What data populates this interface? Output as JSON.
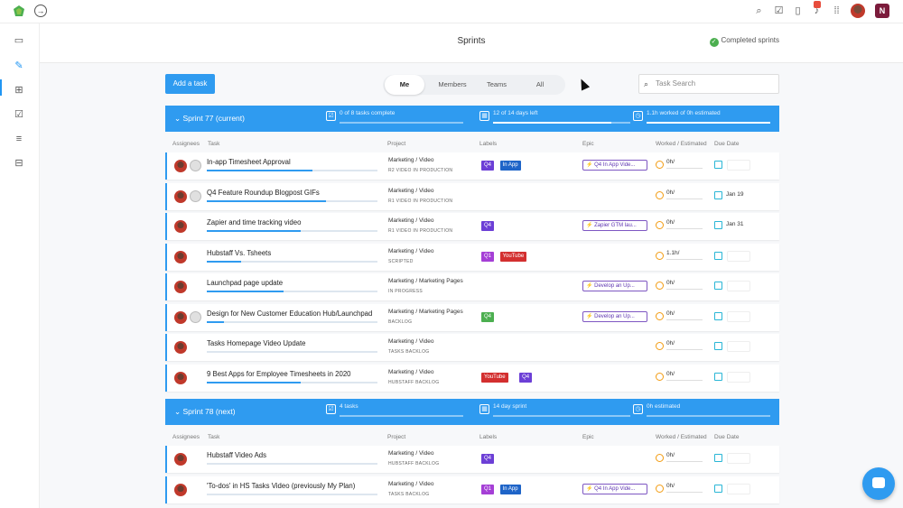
{
  "topbar": {
    "icons": [
      "logo-icon",
      "back-arrow-icon",
      "search-icon",
      "checkbox-icon",
      "timer-icon",
      "bell-icon",
      "grid-icon"
    ],
    "user_initial": "N"
  },
  "header": {
    "title": "Sprints",
    "completed_label": "Completed sprints"
  },
  "sidebar": {
    "icons": [
      "folder-icon",
      "pencil-icon",
      "plus-square-icon",
      "check-square-icon",
      "layers-icon",
      "archive-icon"
    ]
  },
  "toolbar": {
    "add_task": "Add a task",
    "filters": [
      "Me",
      "Members",
      "Teams",
      "All"
    ],
    "search_placeholder": "Task Search"
  },
  "columns": {
    "assignees": "Assignees",
    "task": "Task",
    "project": "Project",
    "labels": "Labels",
    "epic": "Epic",
    "worked": "Worked / Estimated",
    "due": "Due Date"
  },
  "sprints": [
    {
      "name": "Sprint 77 (current)",
      "stats": [
        {
          "text": "0 of 8 tasks complete",
          "progress": 0.0
        },
        {
          "text": "12 of 14 days left",
          "progress": 0.86
        },
        {
          "text": "1.1h worked of 0h estimated",
          "progress": 1.0
        }
      ],
      "tasks": [
        {
          "name": "In-app Timesheet Approval",
          "progress": 0.62,
          "project": "Marketing / Video",
          "status": "R2 VIDEO IN PRODUCTION",
          "labels": [
            {
              "t": "Q4",
              "c": "#6c3fd6"
            },
            {
              "t": "In App",
              "c": "#1e64c8"
            }
          ],
          "epic": "Q4 In App Vide...",
          "worked": "0h/",
          "due": "",
          "two": true
        },
        {
          "name": "Q4 Feature Roundup Blogpost GIFs",
          "progress": 0.7,
          "project": "Marketing / Video",
          "status": "R1 VIDEO IN PRODUCTION",
          "labels": [],
          "epic": "",
          "worked": "0h/",
          "due": "Jan 19",
          "two": true
        },
        {
          "name": "Zapier and time tracking video",
          "progress": 0.55,
          "project": "Marketing / Video",
          "status": "R1 VIDEO IN PRODUCTION",
          "labels": [
            {
              "t": "Q4",
              "c": "#6c3fd6"
            }
          ],
          "epic": "Zapier GTM lau...",
          "worked": "0h/",
          "due": "Jan 31",
          "two": false
        },
        {
          "name": "Hubstaff Vs. Tsheets",
          "progress": 0.2,
          "project": "Marketing / Video",
          "status": "SCRIPTED",
          "labels": [
            {
              "t": "Q1",
              "c": "#a53fd6"
            },
            {
              "t": "YouTube",
              "c": "#d32f2f"
            }
          ],
          "epic": "",
          "worked": "1.1h/",
          "due": "",
          "two": false
        },
        {
          "name": "Launchpad page update",
          "progress": 0.45,
          "project": "Marketing / Marketing Pages",
          "status": "IN PROGRESS",
          "labels": [],
          "epic": "Develop an Up...",
          "worked": "0h/",
          "due": "",
          "two": false
        },
        {
          "name": "Design for New Customer Education Hub/Launchpad",
          "progress": 0.1,
          "project": "Marketing / Marketing Pages",
          "status": "BACKLOG",
          "labels": [
            {
              "t": "Q4",
              "c": "#4caf50"
            }
          ],
          "epic": "Develop an Up...",
          "worked": "0h/",
          "due": "",
          "two": true
        },
        {
          "name": "Tasks Homepage Video Update",
          "progress": 0.0,
          "project": "Marketing / Video",
          "status": "TASKS BACKLOG",
          "labels": [],
          "epic": "",
          "worked": "0h/",
          "due": "",
          "two": false
        },
        {
          "name": "9 Best Apps for Employee Timesheets in 2020",
          "progress": 0.55,
          "project": "Marketing / Video",
          "status": "HUBSTAFF BACKLOG",
          "labels": [
            {
              "t": "YouTube",
              "c": "#d32f2f"
            },
            {
              "t": "Q4",
              "c": "#6c3fd6"
            }
          ],
          "epic": "",
          "worked": "0h/",
          "due": "",
          "two": false
        }
      ]
    },
    {
      "name": "Sprint 78 (next)",
      "stats": [
        {
          "text": "4 tasks",
          "progress": 0.0
        },
        {
          "text": "14 day sprint",
          "progress": 0.0
        },
        {
          "text": "0h estimated",
          "progress": 0.0
        }
      ],
      "tasks": [
        {
          "name": "Hubstaff Video Ads",
          "progress": 0.0,
          "project": "Marketing / Video",
          "status": "HUBSTAFF BACKLOG",
          "labels": [
            {
              "t": "Q4",
              "c": "#6c3fd6"
            }
          ],
          "epic": "",
          "worked": "0h/",
          "due": "",
          "two": false
        },
        {
          "name": "'To-dos' in HS Tasks Video (previously My Plan)",
          "progress": 0.0,
          "project": "Marketing / Video",
          "status": "TASKS BACKLOG",
          "labels": [
            {
              "t": "Q1",
              "c": "#a53fd6"
            },
            {
              "t": "In App",
              "c": "#1e64c8"
            }
          ],
          "epic": "Q4 In App Vide...",
          "worked": "0h/",
          "due": "",
          "two": false
        }
      ]
    }
  ]
}
